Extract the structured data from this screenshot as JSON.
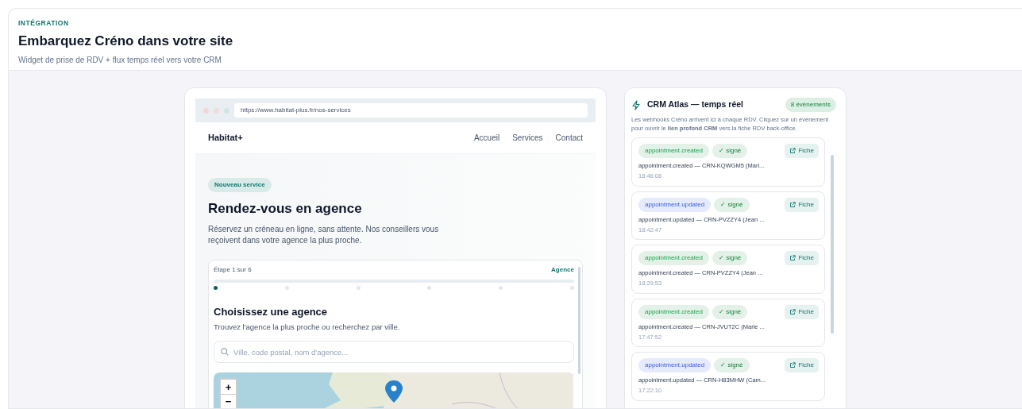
{
  "header": {
    "eyebrow": "INTÉGRATION",
    "title": "Embarquez Créno dans votre site",
    "subtitle": "Widget de prise de RDV + flux temps réel vers votre CRM"
  },
  "preview": {
    "url": "https://www.habitat-plus.fr/nos-services",
    "site_name": "Habitat+",
    "nav": [
      {
        "label": "Accueil"
      },
      {
        "label": "Services"
      },
      {
        "label": "Contact"
      }
    ],
    "badge": "Nouveau service",
    "headline": "Rendez-vous en agence",
    "lead": "Réservez un créneau en ligne, sans attente. Nos conseillers vous reçoivent dans votre agence la plus proche.",
    "widget": {
      "step_label": "Étape 1 sur 6",
      "step_name": "Agence",
      "steps": [
        {
          "selected": true
        },
        {
          "selected": false
        },
        {
          "selected": false
        },
        {
          "selected": false
        },
        {
          "selected": false
        },
        {
          "selected": false
        }
      ],
      "title": "Choisissez une agence",
      "description": "Trouvez l'agence la plus proche ou recherchez par ville.",
      "search": {
        "placeholder": "Ville, code postal, nom d'agence..."
      },
      "map": {
        "zoom_in": "+",
        "zoom_out": "−"
      }
    }
  },
  "crm": {
    "title": "CRM Atlas — temps réel",
    "count": "8 événements",
    "description": "Les webhooks Créno arrivent ici à chaque RDV. Cliquez sur un événement pour ouvrir le **lien profond CRM** vers la fiche RDV back-office.",
    "events": [
      {
        "kind": "created",
        "type": "appointment.created",
        "signature": "✓ signé",
        "action": "Fiche",
        "summary": "appointment.created — CRN-KQWGM5 (Mari...",
        "time": "18:46:08"
      },
      {
        "kind": "updated",
        "type": "appointment.updated",
        "signature": "✓ signé",
        "action": "Fiche",
        "summary": "appointment.updated — CRN-PVZZY4 (Jean ...",
        "time": "18:42:47"
      },
      {
        "kind": "created",
        "type": "appointment.created",
        "signature": "✓ signé",
        "action": "Fiche",
        "summary": "appointment.created — CRN-PVZZY4 (Jean ...",
        "time": "18:29:53"
      },
      {
        "kind": "created",
        "type": "appointment.created",
        "signature": "✓ signé",
        "action": "Fiche",
        "summary": "appointment.created — CRN-JVUT2C (Marie ...",
        "time": "17:47:52"
      },
      {
        "kind": "updated",
        "type": "appointment.updated",
        "signature": "✓ signé",
        "action": "Fiche",
        "summary": "appointment.updated — CRN-H83MHW (Cam...",
        "time": "17:22:10"
      }
    ]
  }
}
